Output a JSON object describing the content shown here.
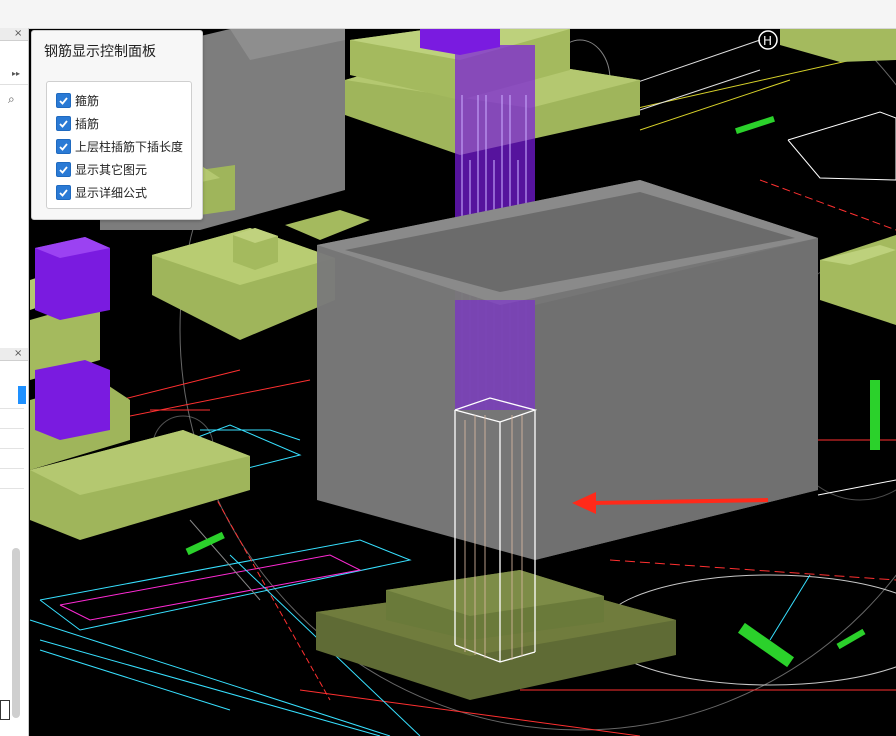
{
  "panel": {
    "title": "钢筋显示控制面板",
    "options": [
      {
        "label": "箍筋",
        "checked": true
      },
      {
        "label": "插筋",
        "checked": true
      },
      {
        "label": "上层柱插筋下插长度",
        "checked": true
      },
      {
        "label": "显示其它图元",
        "checked": true
      },
      {
        "label": "显示详细公式",
        "checked": true
      }
    ]
  },
  "left_panel": {
    "glyphs": [
      "×",
      "▸▸",
      "⌕",
      "×"
    ]
  },
  "colors": {
    "viewport_bg": "#000000",
    "pad_green": "#a4ba5e",
    "column_purple": "#7a1be0",
    "box_gray": "#777777",
    "arrow_red": "#ff2a1a",
    "checkbox_blue": "#2a7ad5"
  }
}
